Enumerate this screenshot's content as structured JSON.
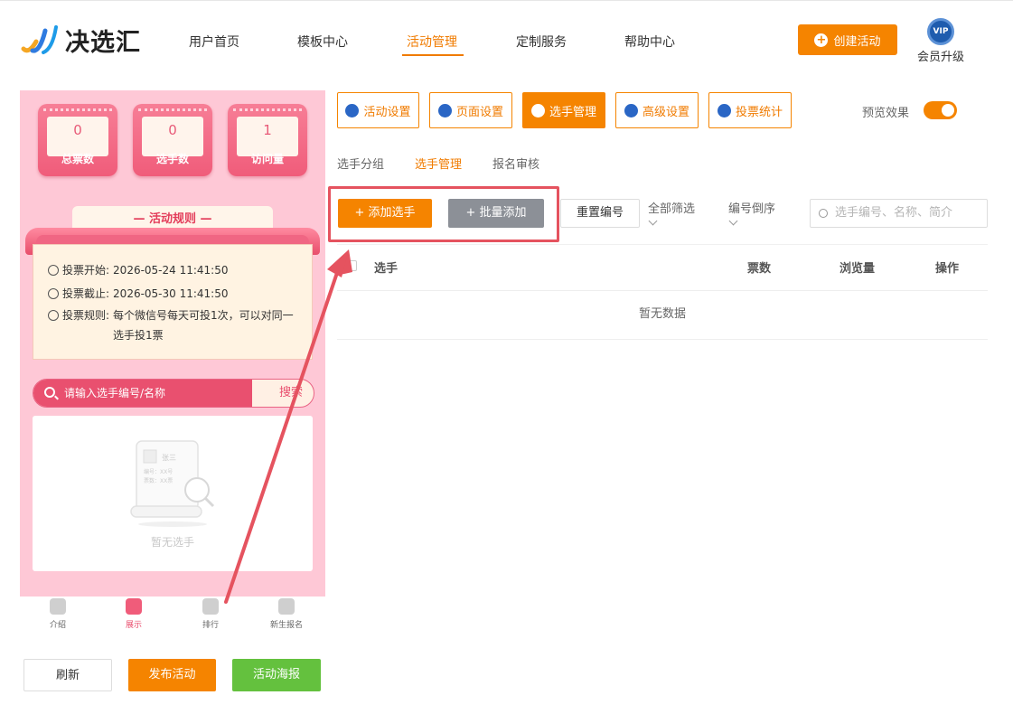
{
  "header": {
    "logo_text": "决选汇",
    "nav": [
      "用户首页",
      "模板中心",
      "活动管理",
      "定制服务",
      "帮助中心"
    ],
    "active_nav": "活动管理",
    "create_button": "创建活动",
    "vip_badge": "VIP",
    "vip_label": "会员升级"
  },
  "preview": {
    "stats": [
      {
        "value": "0",
        "label": "总票数"
      },
      {
        "value": "0",
        "label": "选手数"
      },
      {
        "value": "1",
        "label": "访问量"
      }
    ],
    "rules_title": "— 活动规则 —",
    "rules": [
      {
        "key": "投票开始:",
        "value": "2026-05-24 11:41:50"
      },
      {
        "key": "投票截止:",
        "value": "2026-05-30 11:41:50"
      },
      {
        "key": "投票规则:",
        "value": "每个微信号每天可投1次，可以对同一选手投1票"
      }
    ],
    "search_placeholder": "请输入选手编号/名称",
    "search_button": "搜索",
    "empty_text": "暂无选手",
    "empty_card_name": "张三",
    "empty_card_line1": "编号：XX号",
    "empty_card_line2": "票数：XX票",
    "tabbar": [
      {
        "label": "介绍",
        "active": false
      },
      {
        "label": "展示",
        "active": true
      },
      {
        "label": "排行",
        "active": false
      },
      {
        "label": "新生报名",
        "active": false
      }
    ]
  },
  "bottom_buttons": {
    "refresh": "刷新",
    "publish": "发布活动",
    "poster": "活动海报"
  },
  "toolbar": {
    "items": [
      "活动设置",
      "页面设置",
      "选手管理",
      "高级设置",
      "投票统计"
    ],
    "active": "选手管理",
    "preview_label": "预览效果",
    "preview_on": true
  },
  "subtabs": {
    "items": [
      "选手分组",
      "选手管理",
      "报名审核"
    ],
    "active": "选手管理"
  },
  "actions": {
    "add": "添加选手",
    "batch_add": "批量添加",
    "renumber": "重置编号",
    "filter_all": "全部筛选",
    "sort_number": "编号倒序",
    "search_placeholder": "选手编号、名称、简介"
  },
  "table": {
    "columns": [
      "选手",
      "票数",
      "浏览量",
      "操作"
    ],
    "empty": "暂无数据"
  },
  "colors": {
    "brand_orange": "#f58400",
    "pink_bg": "#fec8d6",
    "annotation_red": "#e5535f",
    "green": "#64c13e"
  }
}
